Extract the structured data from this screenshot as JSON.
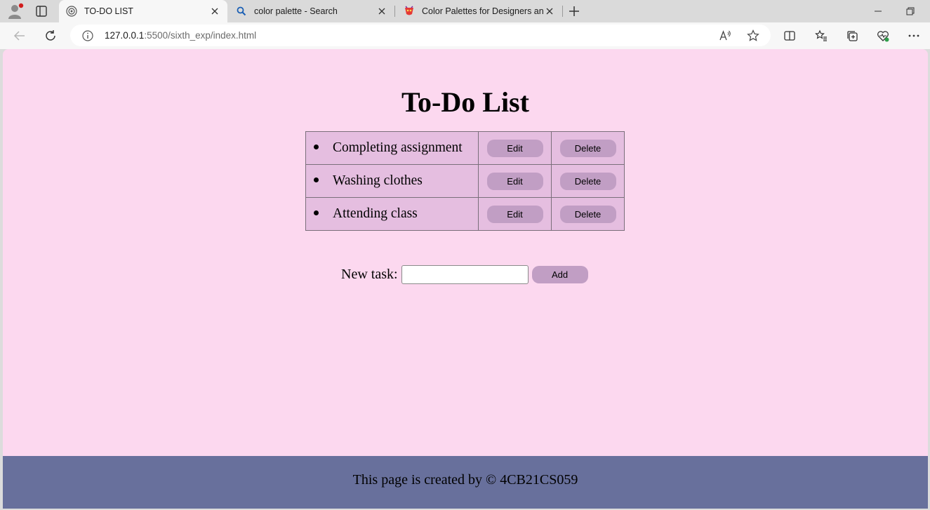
{
  "browser": {
    "tabs": [
      {
        "title": "TO-DO LIST",
        "icon": "broadcast-icon",
        "active": true
      },
      {
        "title": "color palette - Search",
        "icon": "search-icon",
        "active": false
      },
      {
        "title": "Color Palettes for Designers and",
        "icon": "palette-site-icon",
        "active": false
      }
    ],
    "address": {
      "host": "127.0.0.1",
      "path": ":5500/sixth_exp/index.html"
    }
  },
  "page": {
    "title": "To-Do List",
    "tasks": [
      {
        "text": "Completing assignment",
        "edit_label": "Edit",
        "delete_label": "Delete"
      },
      {
        "text": "Washing clothes",
        "edit_label": "Edit",
        "delete_label": "Delete"
      },
      {
        "text": "Attending class",
        "edit_label": "Edit",
        "delete_label": "Delete"
      }
    ],
    "new_task": {
      "label": "New task:",
      "value": "",
      "add_label": "Add"
    },
    "footer": "This page is created by © 4CB21CS059"
  },
  "colors": {
    "page_background": "#fcd8ef",
    "table_background": "#e5bee0",
    "button_background": "#c19ec4",
    "footer_background": "#68709c"
  }
}
